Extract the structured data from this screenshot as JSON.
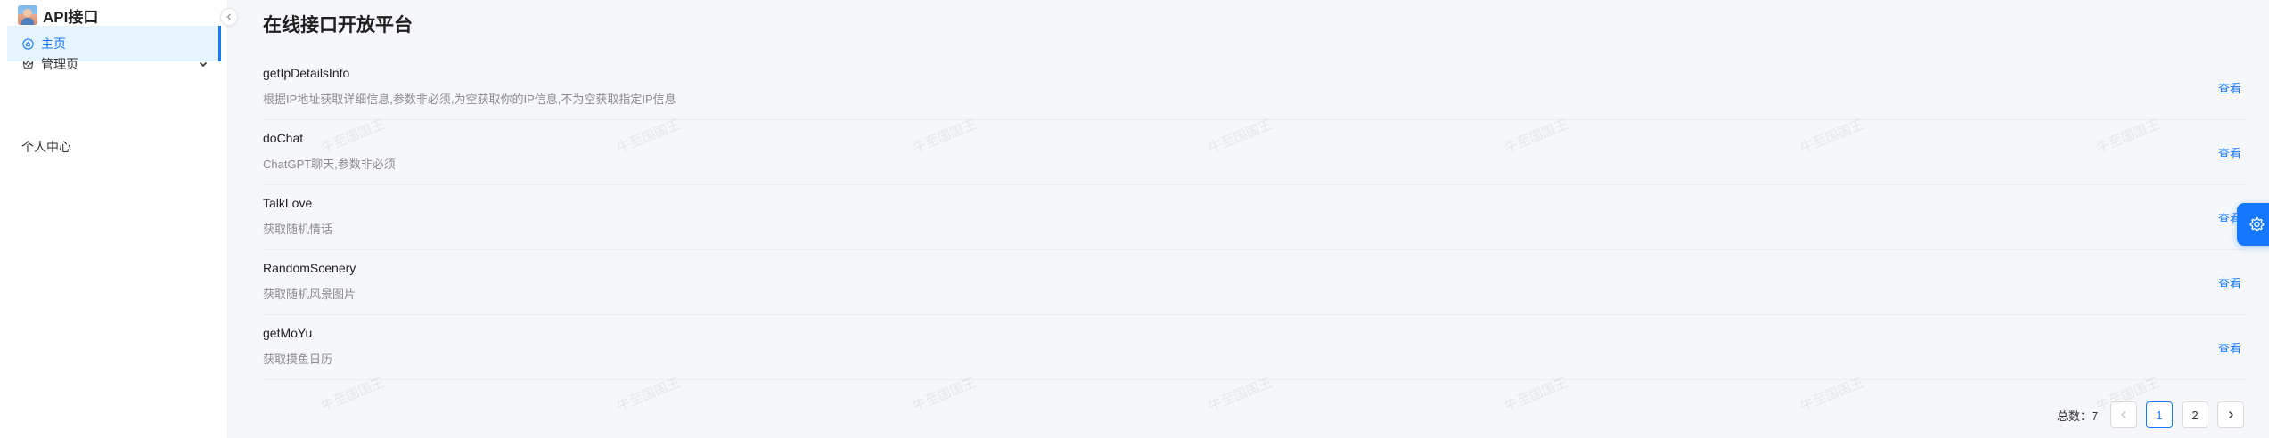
{
  "brand": {
    "title": "API接口"
  },
  "sidebar": {
    "items": [
      {
        "label": "主页",
        "icon": "home-circle-icon",
        "active": true
      },
      {
        "label": "管理页",
        "icon": "crown-icon",
        "expandable": true
      },
      {
        "label": "个人中心"
      }
    ]
  },
  "main": {
    "title": "在线接口开放平台",
    "apis": [
      {
        "name": "getIpDetailsInfo",
        "description": "根据IP地址获取详细信息,参数非必须,为空获取你的IP信息,不为空获取指定IP信息",
        "action": "查看"
      },
      {
        "name": "doChat",
        "description": "ChatGPT聊天,参数非必须",
        "action": "查看"
      },
      {
        "name": "TalkLove",
        "description": "获取随机情话",
        "action": "查看"
      },
      {
        "name": "RandomScenery",
        "description": "获取随机风景图片",
        "action": "查看"
      },
      {
        "name": "getMoYu",
        "description": "获取摸鱼日历",
        "action": "查看"
      }
    ]
  },
  "pagination": {
    "total_label": "总数：7",
    "pages": [
      "1",
      "2"
    ],
    "current": "1"
  },
  "watermark": {
    "text": "牛至国国王"
  },
  "colors": {
    "accent": "#1677ff",
    "active_bg": "#e6f4ff",
    "muted_text": "#8c8c8c"
  }
}
